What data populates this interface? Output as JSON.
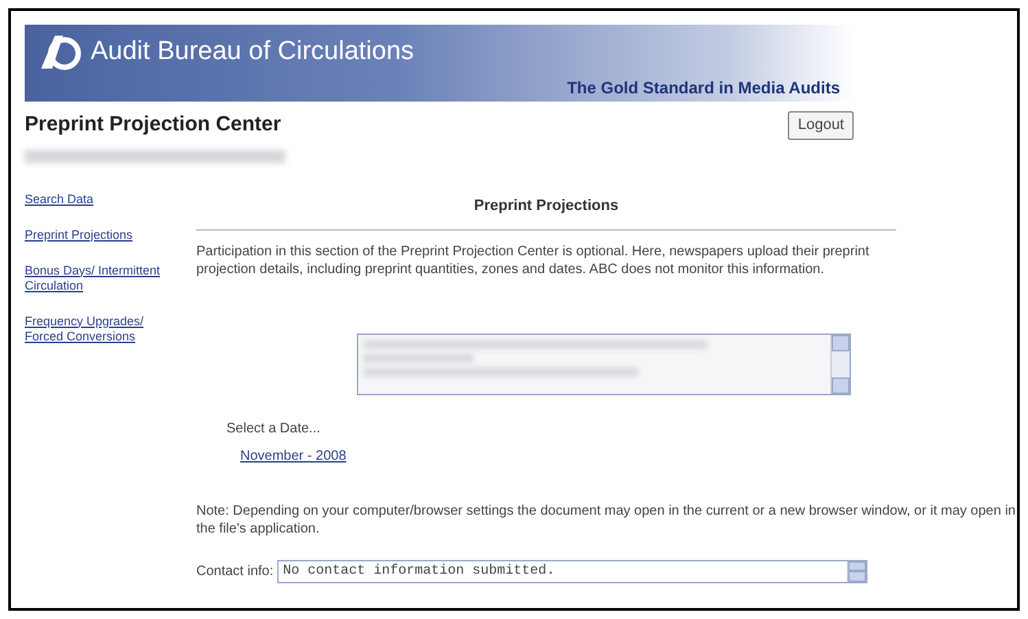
{
  "banner": {
    "title": "Audit Bureau of Circulations",
    "tagline": "The Gold Standard in Media Audits"
  },
  "header": {
    "title": "Preprint Projection Center",
    "logout": "Logout"
  },
  "sidebar": {
    "items": [
      {
        "label": "Search Data"
      },
      {
        "label": "Preprint Projections"
      },
      {
        "label": "Bonus Days/ Intermittent Circulation"
      },
      {
        "label": "Frequency Upgrades/ Forced Conversions"
      }
    ]
  },
  "content": {
    "heading": "Preprint Projections",
    "intro": "Participation in this section of the Preprint Projection Center is optional. Here, newspapers upload their preprint projection details, including preprint quantities, zones and dates. ABC does not monitor this information.",
    "select_label": "Select a Date...",
    "date_link": "November - 2008",
    "note": "Note: Depending on your computer/browser settings the document may open in the current or a new browser window, or it may open in the file's application.",
    "contact_label": "Contact info:",
    "contact_value": "No contact information submitted."
  }
}
